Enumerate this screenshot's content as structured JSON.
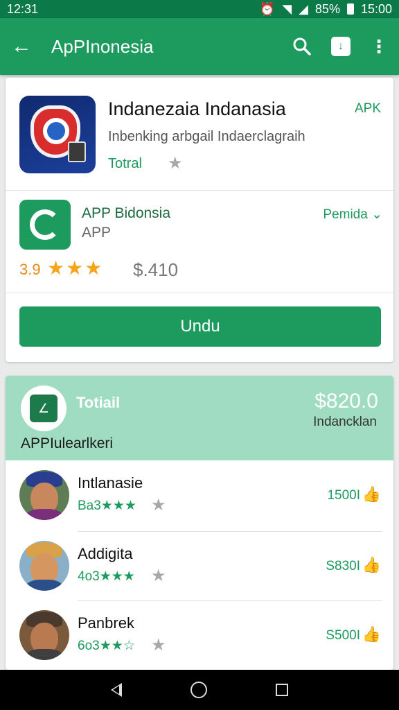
{
  "status_bar": {
    "time": "12:31",
    "battery": "85%",
    "clock": "15:00"
  },
  "app_bar": {
    "title": "ApPInonesia",
    "back_icon": "arrow-left-icon",
    "search_icon": "search-icon",
    "download_icon": "download-icon",
    "more_icon": "more-vert-icon"
  },
  "app_card": {
    "title": "Indanezaia Indanasia",
    "badge": "APK",
    "subtitle": "Inbenking arbgail Indaerclagraih",
    "total_label": "Totral",
    "publisher": {
      "name": "APP Bidonsia",
      "type": "APP",
      "action": "Pemida ⌄"
    },
    "rating": "3.9",
    "stars": "★★★",
    "price": "$.410",
    "download_label": "Undu"
  },
  "summary_card": {
    "badge_glyph": "∠",
    "total_label": "Totiail",
    "amount": "$820.0",
    "sub_label": "Indancklan",
    "caption": "APPIulearlkeri",
    "entries": [
      {
        "name": "Intlanasie",
        "rating_text": "Ba3★★★",
        "amount": "1500I",
        "skin": "#c9875d",
        "hat": "#2a3e8f",
        "body": "#7a2f7a",
        "bg": "#5f7d55"
      },
      {
        "name": "Addigita",
        "rating_text": "4o3★★★",
        "amount": "S830I",
        "skin": "#d6965f",
        "hat": "#d9a24a",
        "body": "#2a4f8a",
        "bg": "#8ab0c9"
      },
      {
        "name": "Panbrek",
        "rating_text": "6o3★★☆",
        "amount": "S500I",
        "skin": "#b97a52",
        "hat": "#4a3a2e",
        "body": "#3f3f3f",
        "bg": "#7a5a3a"
      }
    ]
  },
  "nav_bar": {
    "back_icon": "nav-back-icon",
    "home_icon": "nav-home-icon",
    "recent_icon": "nav-recent-icon"
  }
}
